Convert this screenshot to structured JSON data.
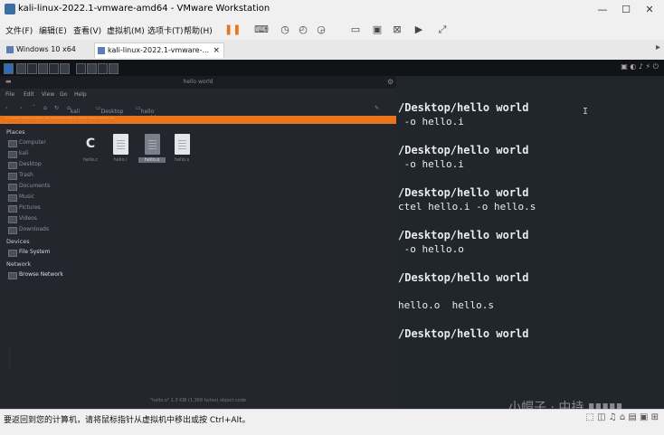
{
  "window": {
    "title": "kali-linux-2022.1-vmware-amd64 - VMware Workstation",
    "controls": {
      "minimize": "—",
      "maximize": "☐",
      "close": "✕"
    }
  },
  "menu": {
    "items": [
      "文件(F)",
      "编辑(E)",
      "查看(V)",
      "虚拟机(M)",
      "选项卡(T)",
      "帮助(H)"
    ]
  },
  "toolbar": {
    "icons": [
      "pause-icon",
      "send-keys-icon",
      "snapshot-icon",
      "snapshot-revert-icon",
      "snapshot-manager-icon",
      "fullscreen-icon",
      "unity-icon",
      "console-icon",
      "stretch-icon"
    ]
  },
  "tabs": [
    {
      "label": "Windows 10 x64"
    },
    {
      "label": "kali-linux-2022.1-vmware-...",
      "close": "×"
    }
  ],
  "file_manager": {
    "title": "hello world",
    "menu": [
      "File",
      "Edit",
      "View",
      "Go",
      "Help"
    ],
    "toolbar": [
      "kali",
      "Desktop",
      "hello world"
    ],
    "places_heading": "Places",
    "places": [
      "Computer",
      "kali",
      "Desktop",
      "Trash",
      "Documents",
      "Music",
      "Pictures",
      "Videos",
      "Downloads"
    ],
    "devices_heading": "Devices",
    "devices": [
      "File System"
    ],
    "network_heading": "Network",
    "network": [
      "Browse Network"
    ],
    "files": [
      {
        "name": "hello.c",
        "kind": "c-source"
      },
      {
        "name": "hello.i",
        "kind": "text"
      },
      {
        "name": "hello.o",
        "kind": "text",
        "selected": true
      },
      {
        "name": "hello.s",
        "kind": "text"
      }
    ],
    "status": "\"hello.o\" 1.3 KiB (1,368 bytes) object code"
  },
  "terminal": {
    "lines": [
      {
        "text": "/Desktop/hello world",
        "style": "b"
      },
      {
        "text": " -o hello.i",
        "style": "n"
      },
      {
        "text": "/Desktop/hello world",
        "style": "b"
      },
      {
        "text": " -o hello.i",
        "style": "n"
      },
      {
        "text": "/Desktop/hello world",
        "style": "b"
      },
      {
        "text": "ctel hello.i -o hello.s",
        "style": "n"
      },
      {
        "text": "/Desktop/hello world",
        "style": "b"
      },
      {
        "text": " -o hello.o",
        "style": "n"
      },
      {
        "text": "/Desktop/hello world",
        "style": "b"
      },
      {
        "text": "hello.o  hello.s",
        "style": "n"
      },
      {
        "text": "/Desktop/hello world",
        "style": "b"
      }
    ],
    "cursor": "I"
  },
  "watermark": "小帽子 · 中持 ▮▮▮▮▮",
  "statusbar": {
    "message": "要返回到您的计算机，请将鼠标指针从虚拟机中移出或按 Ctrl+Alt。"
  }
}
